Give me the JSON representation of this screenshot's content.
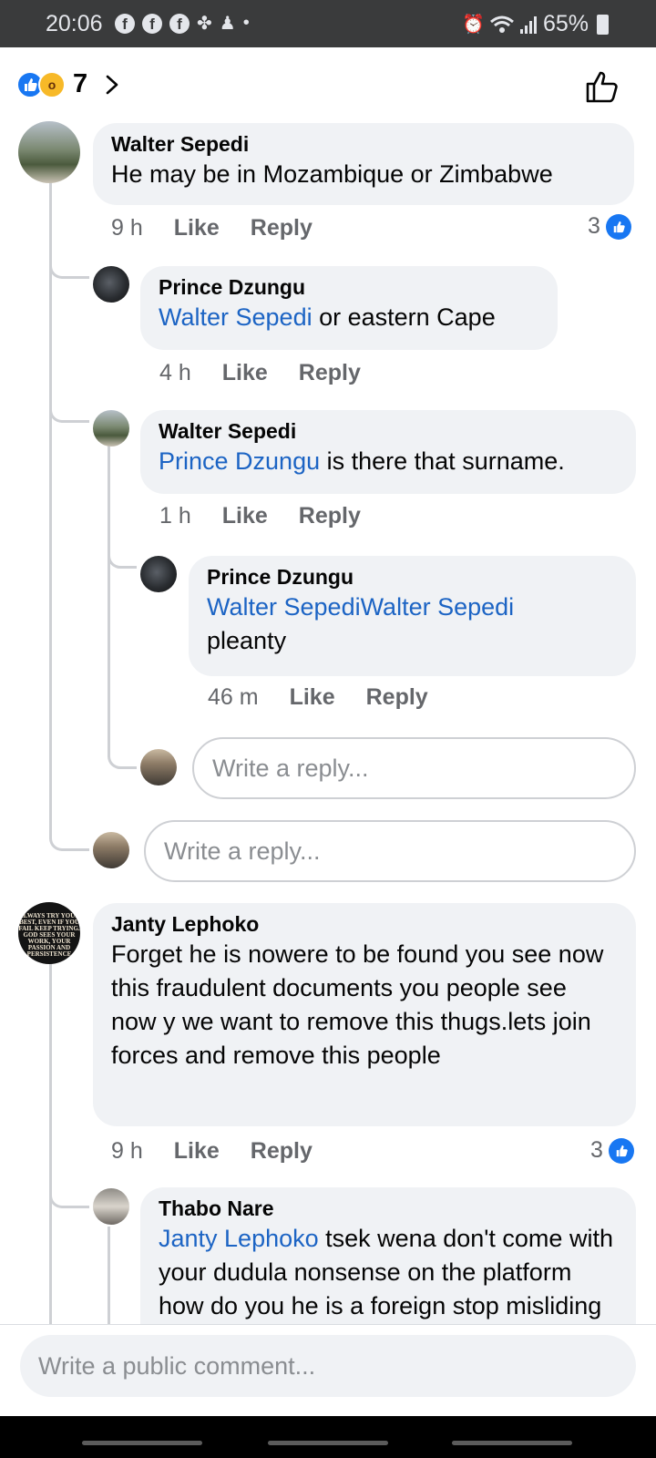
{
  "status_bar": {
    "time": "20:06",
    "notification_icons": [
      "facebook-icon",
      "facebook-icon",
      "facebook-icon",
      "pinwheel-icon",
      "person-icon",
      "dot-icon"
    ],
    "battery": "65%"
  },
  "reactions": {
    "count": "7"
  },
  "comments": [
    {
      "author": "Walter Sepedi",
      "text": "He may be in Mozambique or Zimbabwe",
      "time": "9 h",
      "like": "Like",
      "reply": "Reply",
      "reaction_count": "3"
    },
    {
      "author": "Prince Dzungu",
      "mention": "Walter Sepedi",
      "text": " or eastern Cape",
      "time": "4 h",
      "like": "Like",
      "reply": "Reply"
    },
    {
      "author": "Walter Sepedi",
      "mention": "Prince Dzungu",
      "text": " is there that surname.",
      "time": "1 h",
      "like": "Like",
      "reply": "Reply"
    },
    {
      "author": "Prince Dzungu",
      "mention": "Walter SepediWalter Sepedi",
      "text": "pleanty",
      "time": "46 m",
      "like": "Like",
      "reply": "Reply"
    },
    {
      "author": "Janty Lephoko",
      "text": "Forget he is nowere to be found you see now this fraudulent documents you people see now y we want to remove this thugs.lets join forces and remove this people",
      "time": "9 h",
      "like": "Like",
      "reply": "Reply",
      "reaction_count": "3"
    },
    {
      "author": "Thabo Nare",
      "mention": "Janty Lephoko",
      "text": " tsek wena don't come with your dudula nonsense on the platform how do you he is a foreign stop misliding people act as if you"
    }
  ],
  "reply_placeholder": "Write a reply...",
  "avatar_quote": "ALWAYS TRY YOUR BEST, EVEN IF YOU FAIL KEEP TRYING. GOD SEES YOUR WORK, YOUR PASSION AND PERSISTENCE",
  "composer_placeholder": "Write a public comment...",
  "colors": {
    "mention": "#1c64c4",
    "like_blue": "#1877f2",
    "bubble": "#f0f2f5"
  }
}
